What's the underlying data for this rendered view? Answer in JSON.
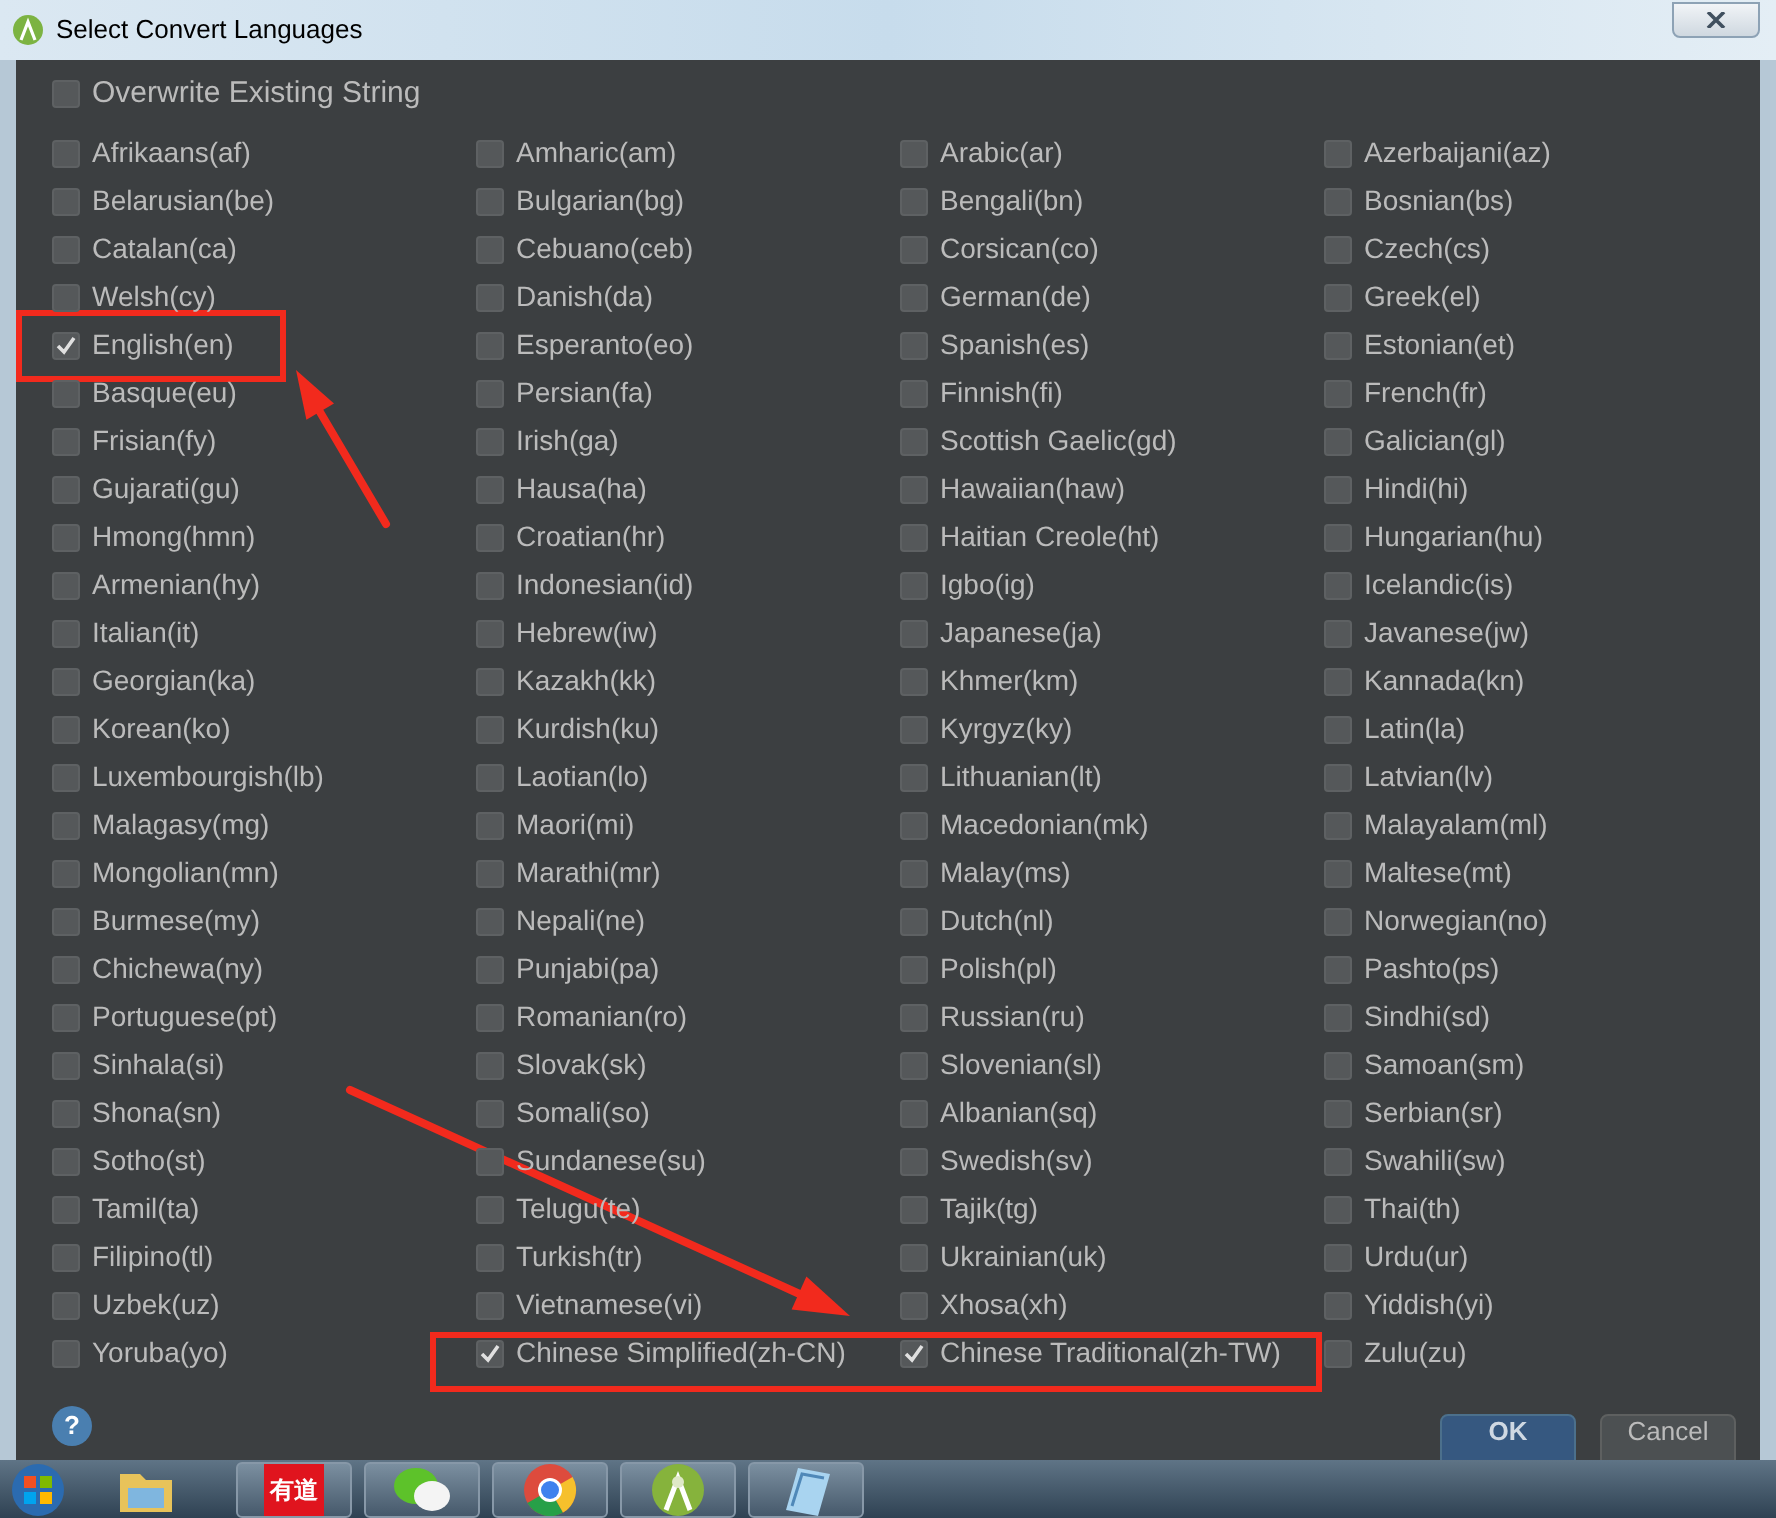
{
  "window": {
    "title": "Select Convert Languages"
  },
  "overwrite": {
    "label": "Overwrite Existing String",
    "checked": false
  },
  "languages": [
    {
      "label": "Afrikaans(af)",
      "checked": false
    },
    {
      "label": "Amharic(am)",
      "checked": false
    },
    {
      "label": "Arabic(ar)",
      "checked": false
    },
    {
      "label": "Azerbaijani(az)",
      "checked": false
    },
    {
      "label": "Belarusian(be)",
      "checked": false
    },
    {
      "label": "Bulgarian(bg)",
      "checked": false
    },
    {
      "label": "Bengali(bn)",
      "checked": false
    },
    {
      "label": "Bosnian(bs)",
      "checked": false
    },
    {
      "label": "Catalan(ca)",
      "checked": false
    },
    {
      "label": "Cebuano(ceb)",
      "checked": false
    },
    {
      "label": "Corsican(co)",
      "checked": false
    },
    {
      "label": "Czech(cs)",
      "checked": false
    },
    {
      "label": "Welsh(cy)",
      "checked": false
    },
    {
      "label": "Danish(da)",
      "checked": false
    },
    {
      "label": "German(de)",
      "checked": false
    },
    {
      "label": "Greek(el)",
      "checked": false
    },
    {
      "label": "English(en)",
      "checked": true
    },
    {
      "label": "Esperanto(eo)",
      "checked": false
    },
    {
      "label": "Spanish(es)",
      "checked": false
    },
    {
      "label": "Estonian(et)",
      "checked": false
    },
    {
      "label": "Basque(eu)",
      "checked": false
    },
    {
      "label": "Persian(fa)",
      "checked": false
    },
    {
      "label": "Finnish(fi)",
      "checked": false
    },
    {
      "label": "French(fr)",
      "checked": false
    },
    {
      "label": "Frisian(fy)",
      "checked": false
    },
    {
      "label": "Irish(ga)",
      "checked": false
    },
    {
      "label": "Scottish Gaelic(gd)",
      "checked": false
    },
    {
      "label": "Galician(gl)",
      "checked": false
    },
    {
      "label": "Gujarati(gu)",
      "checked": false
    },
    {
      "label": "Hausa(ha)",
      "checked": false
    },
    {
      "label": "Hawaiian(haw)",
      "checked": false
    },
    {
      "label": "Hindi(hi)",
      "checked": false
    },
    {
      "label": "Hmong(hmn)",
      "checked": false
    },
    {
      "label": "Croatian(hr)",
      "checked": false
    },
    {
      "label": "Haitian Creole(ht)",
      "checked": false
    },
    {
      "label": "Hungarian(hu)",
      "checked": false
    },
    {
      "label": "Armenian(hy)",
      "checked": false
    },
    {
      "label": "Indonesian(id)",
      "checked": false
    },
    {
      "label": "Igbo(ig)",
      "checked": false
    },
    {
      "label": "Icelandic(is)",
      "checked": false
    },
    {
      "label": "Italian(it)",
      "checked": false
    },
    {
      "label": "Hebrew(iw)",
      "checked": false
    },
    {
      "label": "Japanese(ja)",
      "checked": false
    },
    {
      "label": "Javanese(jw)",
      "checked": false
    },
    {
      "label": "Georgian(ka)",
      "checked": false
    },
    {
      "label": "Kazakh(kk)",
      "checked": false
    },
    {
      "label": "Khmer(km)",
      "checked": false
    },
    {
      "label": "Kannada(kn)",
      "checked": false
    },
    {
      "label": "Korean(ko)",
      "checked": false
    },
    {
      "label": "Kurdish(ku)",
      "checked": false
    },
    {
      "label": "Kyrgyz(ky)",
      "checked": false
    },
    {
      "label": "Latin(la)",
      "checked": false
    },
    {
      "label": "Luxembourgish(lb)",
      "checked": false
    },
    {
      "label": "Laotian(lo)",
      "checked": false
    },
    {
      "label": "Lithuanian(lt)",
      "checked": false
    },
    {
      "label": "Latvian(lv)",
      "checked": false
    },
    {
      "label": "Malagasy(mg)",
      "checked": false
    },
    {
      "label": "Maori(mi)",
      "checked": false
    },
    {
      "label": "Macedonian(mk)",
      "checked": false
    },
    {
      "label": "Malayalam(ml)",
      "checked": false
    },
    {
      "label": "Mongolian(mn)",
      "checked": false
    },
    {
      "label": "Marathi(mr)",
      "checked": false
    },
    {
      "label": "Malay(ms)",
      "checked": false
    },
    {
      "label": "Maltese(mt)",
      "checked": false
    },
    {
      "label": "Burmese(my)",
      "checked": false
    },
    {
      "label": "Nepali(ne)",
      "checked": false
    },
    {
      "label": "Dutch(nl)",
      "checked": false
    },
    {
      "label": "Norwegian(no)",
      "checked": false
    },
    {
      "label": "Chichewa(ny)",
      "checked": false
    },
    {
      "label": "Punjabi(pa)",
      "checked": false
    },
    {
      "label": "Polish(pl)",
      "checked": false
    },
    {
      "label": "Pashto(ps)",
      "checked": false
    },
    {
      "label": "Portuguese(pt)",
      "checked": false
    },
    {
      "label": "Romanian(ro)",
      "checked": false
    },
    {
      "label": "Russian(ru)",
      "checked": false
    },
    {
      "label": "Sindhi(sd)",
      "checked": false
    },
    {
      "label": "Sinhala(si)",
      "checked": false
    },
    {
      "label": "Slovak(sk)",
      "checked": false
    },
    {
      "label": "Slovenian(sl)",
      "checked": false
    },
    {
      "label": "Samoan(sm)",
      "checked": false
    },
    {
      "label": "Shona(sn)",
      "checked": false
    },
    {
      "label": "Somali(so)",
      "checked": false
    },
    {
      "label": "Albanian(sq)",
      "checked": false
    },
    {
      "label": "Serbian(sr)",
      "checked": false
    },
    {
      "label": "Sotho(st)",
      "checked": false
    },
    {
      "label": "Sundanese(su)",
      "checked": false
    },
    {
      "label": "Swedish(sv)",
      "checked": false
    },
    {
      "label": "Swahili(sw)",
      "checked": false
    },
    {
      "label": "Tamil(ta)",
      "checked": false
    },
    {
      "label": "Telugu(te)",
      "checked": false
    },
    {
      "label": "Tajik(tg)",
      "checked": false
    },
    {
      "label": "Thai(th)",
      "checked": false
    },
    {
      "label": "Filipino(tl)",
      "checked": false
    },
    {
      "label": "Turkish(tr)",
      "checked": false
    },
    {
      "label": "Ukrainian(uk)",
      "checked": false
    },
    {
      "label": "Urdu(ur)",
      "checked": false
    },
    {
      "label": "Uzbek(uz)",
      "checked": false
    },
    {
      "label": "Vietnamese(vi)",
      "checked": false
    },
    {
      "label": "Xhosa(xh)",
      "checked": false
    },
    {
      "label": "Yiddish(yi)",
      "checked": false
    },
    {
      "label": "Yoruba(yo)",
      "checked": false
    },
    {
      "label": "Chinese Simplified(zh-CN)",
      "checked": true
    },
    {
      "label": "Chinese Traditional(zh-TW)",
      "checked": true
    },
    {
      "label": "Zulu(zu)",
      "checked": false
    }
  ],
  "help": {
    "label": "?"
  },
  "buttons": [
    {
      "label": "OK",
      "kind": "primary"
    },
    {
      "label": "Cancel",
      "kind": "secondary"
    }
  ],
  "taskbar": {
    "apps": [
      {
        "kind": "folder"
      },
      {
        "kind": "dictionary",
        "label": "有道"
      },
      {
        "kind": "chat"
      },
      {
        "kind": "browser"
      },
      {
        "kind": "android"
      },
      {
        "kind": "notepad"
      }
    ]
  }
}
